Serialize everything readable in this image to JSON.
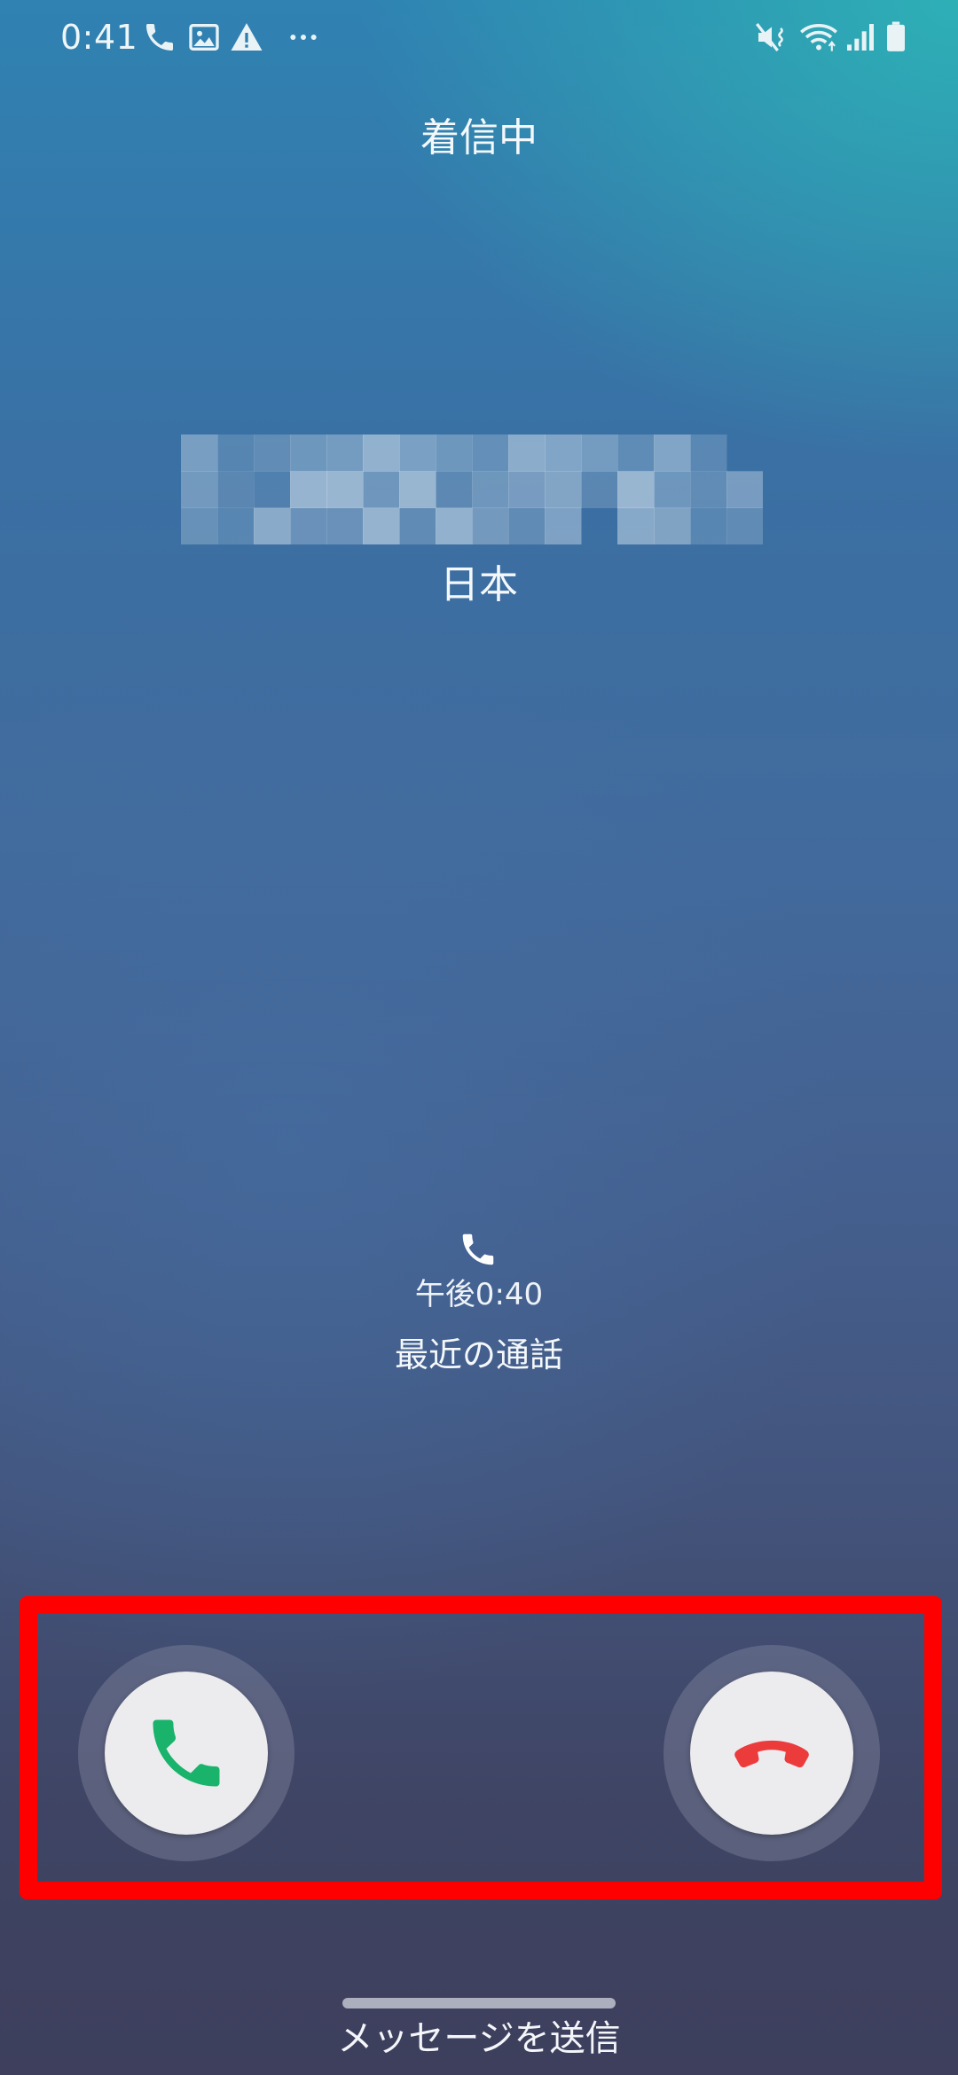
{
  "status_bar": {
    "time": "0:41",
    "left_icons": [
      "phone-icon",
      "gallery-icon",
      "warning-icon",
      "more-dots-icon"
    ],
    "right_icons": [
      "mute-vibrate-icon",
      "wifi-icon",
      "signal-icon",
      "battery-icon"
    ]
  },
  "call": {
    "state": "着信中",
    "caller_number_redacted": true,
    "region": "日本"
  },
  "recent": {
    "icon": "phone-icon",
    "time": "午後0:40",
    "label": "最近の通話"
  },
  "actions": {
    "accept_icon": "phone-accept-icon",
    "decline_icon": "phone-decline-icon"
  },
  "bottom": {
    "send_message_label": "メッセージを送信"
  },
  "colors": {
    "accept": "#19b36b",
    "decline": "#ec3b3b",
    "highlight": "#ff0000",
    "button_face": "#ececef"
  }
}
